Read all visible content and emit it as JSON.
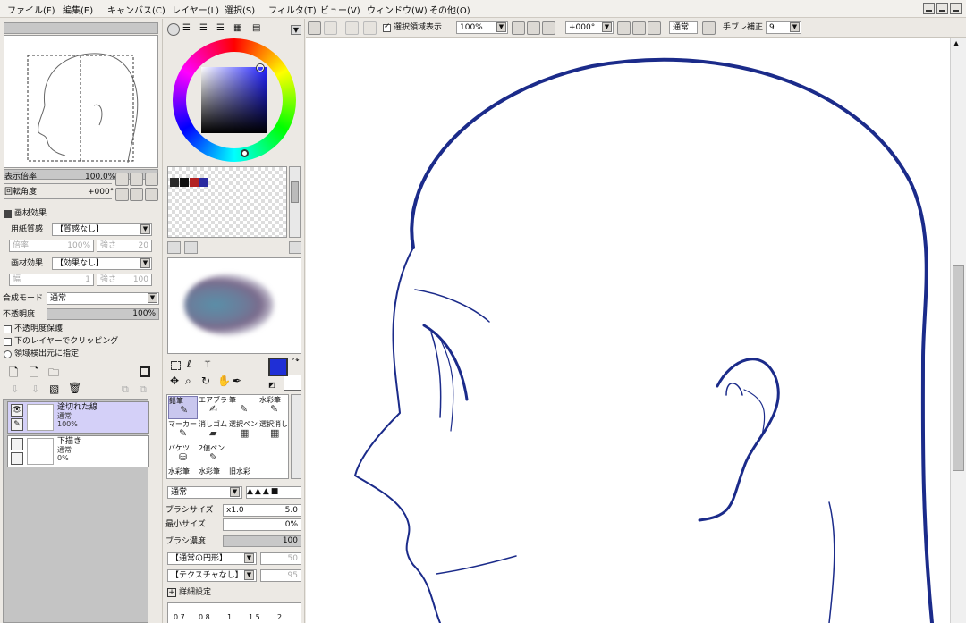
{
  "menu": [
    "ファイル(F)",
    "編集(E)",
    "キャンバス(C)",
    "レイヤー(L)",
    "選択(S)",
    "フィルタ(T)",
    "ビュー(V)",
    "ウィンドウ(W)",
    "その他(O)"
  ],
  "toolbar": {
    "selection_checkbox_label": "選択領域表示",
    "zoom": "100%",
    "rotation": "+000°",
    "blend": "通常",
    "stabilizer_label": "手ブレ補正",
    "stabilizer_value": "9"
  },
  "navigator": {
    "zoom_label": "表示倍率",
    "zoom_value": "100.0%",
    "rotation_label": "回転角度",
    "rotation_value": "+000°"
  },
  "material": {
    "header": "画材効果",
    "paper_label": "用紙質感",
    "paper_value": "【質感なし】",
    "paper_sub1": "倍率",
    "paper_sub1_val": "100%",
    "paper_sub2": "強さ",
    "paper_sub2_val": "20",
    "effect_label": "画材効果",
    "effect_value": "【効果なし】",
    "effect_sub1": "幅",
    "effect_sub1_val": "1",
    "effect_sub2": "強さ",
    "effect_sub2_val": "100"
  },
  "layer_props": {
    "mode_label": "合成モード",
    "mode_value": "通常",
    "opacity_label": "不透明度",
    "opacity_value": "100%",
    "opt1": "不透明度保護",
    "opt2": "下のレイヤーでクリッピング",
    "opt3": "領域検出元に指定"
  },
  "layers": [
    {
      "name": "途切れた線",
      "mode": "通常",
      "opacity": "100%"
    },
    {
      "name": "下描き",
      "mode": "通常",
      "opacity": "0%"
    }
  ],
  "tools": {
    "row1": [
      "鉛筆",
      "エアブラシ",
      "筆",
      "水彩筆"
    ],
    "row2": [
      "マーカー",
      "消しゴム",
      "選択ペン",
      "選択消し"
    ],
    "row3": [
      "バケツ",
      "2値ペン",
      "",
      ""
    ],
    "row4": [
      "水彩筆",
      "水彩筆",
      "旧水彩",
      ""
    ]
  },
  "brush": {
    "mode": "通常",
    "size_label": "ブラシサイズ",
    "size_mult": "x1.0",
    "size_value": "5.0",
    "min_label": "最小サイズ",
    "min_value": "0%",
    "density_label": "ブラシ濃度",
    "density_value": "100",
    "shape": "【通常の円形】",
    "shape_val": "50",
    "texture": "【テクスチャなし】",
    "texture_val": "95",
    "detail_label": "詳細設定"
  },
  "brush_sizes": [
    "0.7",
    "0.8",
    "1",
    "1.5",
    "2"
  ],
  "colors": {
    "main": "#1f2fd6",
    "accent": "#1b2b8a",
    "palette": [
      "#2a2a2a",
      "#111111",
      "#b22222",
      "#2a2aa0"
    ]
  }
}
